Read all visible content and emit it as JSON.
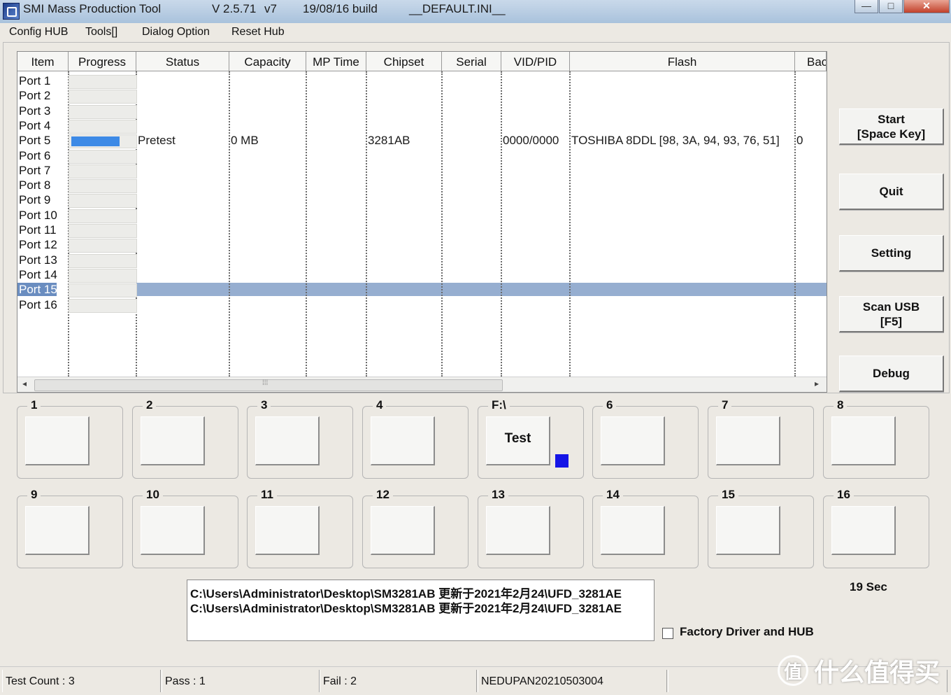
{
  "window": {
    "app_name": "SMI Mass Production Tool",
    "version": "V 2.5.71",
    "variant": "v7",
    "build": "19/08/16 build",
    "ini": "__DEFAULT.INI__",
    "minimize": "—",
    "maximize": "□",
    "close": "✕"
  },
  "menu": [
    "Config HUB",
    "Tools[]",
    "Dialog Option",
    "Reset Hub"
  ],
  "list": {
    "columns": [
      "Item",
      "Progress",
      "Status",
      "Capacity",
      "MP Time",
      "Chipset",
      "Serial",
      "VID/PID",
      "Flash",
      "Bac"
    ],
    "ports": [
      "Port 1",
      "Port 2",
      "Port 3",
      "Port 4",
      "Port 5",
      "Port 6",
      "Port 7",
      "Port 8",
      "Port 9",
      "Port 10",
      "Port 11",
      "Port 12",
      "Port 13",
      "Port 14",
      "Port 15",
      "Port 16"
    ],
    "selected_port": "Port 15",
    "active_row": {
      "port": "Port 5",
      "progress_fraction": 0.77,
      "status": "Pretest",
      "capacity": "0 MB",
      "chipset": "3281AB",
      "vid_pid": "0000/0000",
      "flash": "TOSHIBA 8DDL [98, 3A, 94, 93, 76, 51]",
      "bac": "0"
    },
    "scroll_grip": "⁞⁞⁞"
  },
  "side_buttons": {
    "start": "Start\n[Space Key]",
    "quit": "Quit",
    "setting": "Setting",
    "scan_usb": "Scan USB\n[F5]",
    "debug": "Debug"
  },
  "slots": [
    {
      "label": "1",
      "button": ""
    },
    {
      "label": "2",
      "button": ""
    },
    {
      "label": "3",
      "button": ""
    },
    {
      "label": "4",
      "button": ""
    },
    {
      "label": "F:\\",
      "button": "Test",
      "indicator_color": "#1414e6"
    },
    {
      "label": "6",
      "button": ""
    },
    {
      "label": "7",
      "button": ""
    },
    {
      "label": "8",
      "button": ""
    },
    {
      "label": "9",
      "button": ""
    },
    {
      "label": "10",
      "button": ""
    },
    {
      "label": "11",
      "button": ""
    },
    {
      "label": "12",
      "button": ""
    },
    {
      "label": "13",
      "button": ""
    },
    {
      "label": "14",
      "button": ""
    },
    {
      "label": "15",
      "button": ""
    },
    {
      "label": "16",
      "button": ""
    }
  ],
  "log_lines": [
    "C:\\Users\\Administrator\\Desktop\\SM3281AB 更新于2021年2月24\\UFD_3281AE",
    "C:\\Users\\Administrator\\Desktop\\SM3281AB 更新于2021年2月24\\UFD_3281AE"
  ],
  "timer": "19 Sec",
  "factory_checkbox": {
    "label": "Factory Driver and HUB",
    "checked": false
  },
  "statusbar": [
    "Test Count : 3",
    "Pass : 1",
    "Fail : 2",
    "NEDUPAN20210503004",
    ""
  ],
  "watermark": {
    "logo_char": "值",
    "text": "什么值得买"
  },
  "colors": {
    "progress": "#3d8ae6",
    "selection": "#96aed0",
    "indicator": "#1414e6"
  }
}
